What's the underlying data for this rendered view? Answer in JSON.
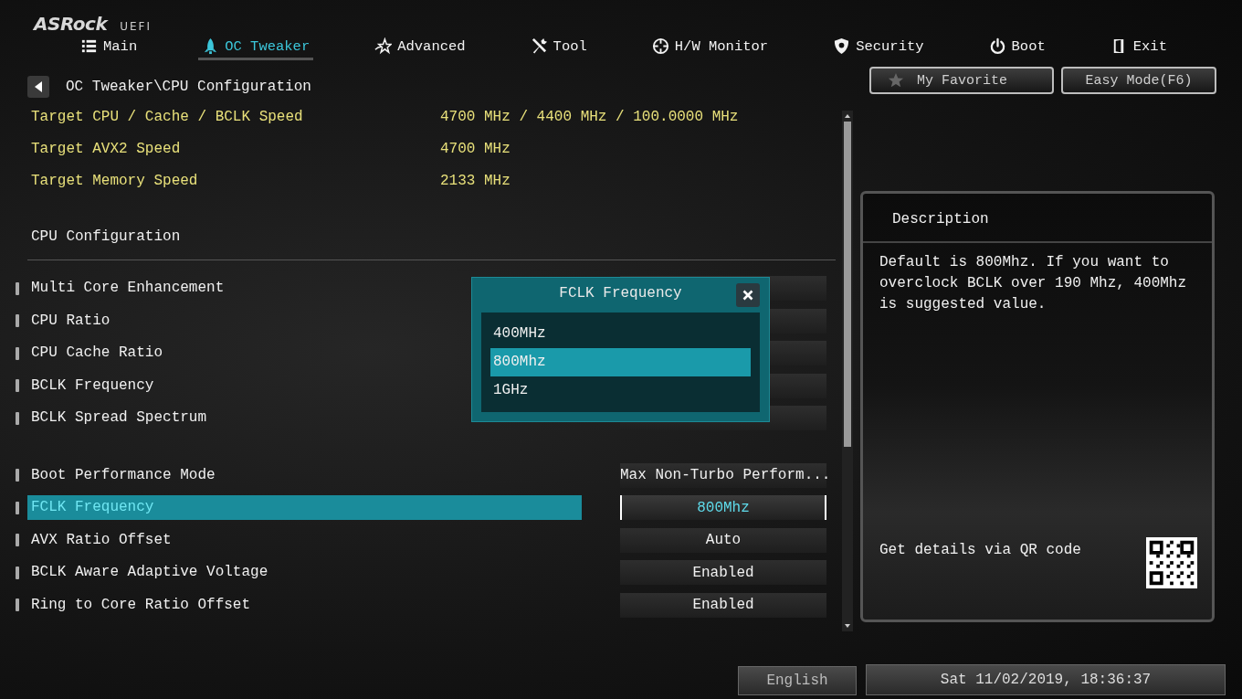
{
  "logo": {
    "brand": "ASRock",
    "suffix": "UEFI"
  },
  "tabs": [
    {
      "label": "Main",
      "selected": false
    },
    {
      "label": "OC Tweaker",
      "selected": true
    },
    {
      "label": "Advanced",
      "selected": false
    },
    {
      "label": "Tool",
      "selected": false
    },
    {
      "label": "H/W Monitor",
      "selected": false
    },
    {
      "label": "Security",
      "selected": false
    },
    {
      "label": "Boot",
      "selected": false
    },
    {
      "label": "Exit",
      "selected": false
    }
  ],
  "breadcrumb": "OC Tweaker\\CPU Configuration",
  "info_rows": [
    {
      "label": "Target CPU / Cache / BCLK Speed",
      "value": "4700 MHz / 4400 MHz / 100.0000 MHz"
    },
    {
      "label": "Target AVX2 Speed",
      "value": "4700 MHz"
    },
    {
      "label": "Target Memory Speed",
      "value": "2133 MHz"
    }
  ],
  "section_title": "CPU Configuration",
  "setting_groups": [
    {
      "rows": [
        {
          "label": "Multi Core Enhancement",
          "selected": false
        },
        {
          "label": "CPU Ratio",
          "selected": false
        },
        {
          "label": "CPU Cache Ratio",
          "selected": false
        },
        {
          "label": "BCLK Frequency",
          "selected": false
        },
        {
          "label": "BCLK Spread Spectrum",
          "selected": false
        }
      ]
    },
    {
      "rows": [
        {
          "label": "Boot Performance Mode",
          "value": "Max Non-Turbo Perform...",
          "selected": false
        },
        {
          "label": "FCLK Frequency",
          "value": "800Mhz",
          "selected": true
        },
        {
          "label": "AVX Ratio Offset",
          "value": "Auto",
          "selected": false
        },
        {
          "label": "BCLK Aware Adaptive Voltage",
          "value": "Enabled",
          "selected": false
        },
        {
          "label": "Ring to Core Ratio Offset",
          "value": "Enabled",
          "selected": false
        }
      ]
    }
  ],
  "popup": {
    "title": "FCLK Frequency",
    "options": [
      {
        "label": "400MHz",
        "selected": false
      },
      {
        "label": "800Mhz",
        "selected": true
      },
      {
        "label": "1GHz",
        "selected": false
      }
    ]
  },
  "top_buttons": [
    {
      "label": "My Favorite"
    },
    {
      "label": "Easy Mode(F6)"
    }
  ],
  "description": {
    "title": "Description",
    "text": "Default is 800Mhz. If you want to overclock BCLK over 190 Mhz, 400Mhz is suggested value.",
    "qr_label": "Get details via QR code"
  },
  "status_bar": {
    "language": "English",
    "datetime": "Sat 11/02/2019, 18:36:37"
  }
}
